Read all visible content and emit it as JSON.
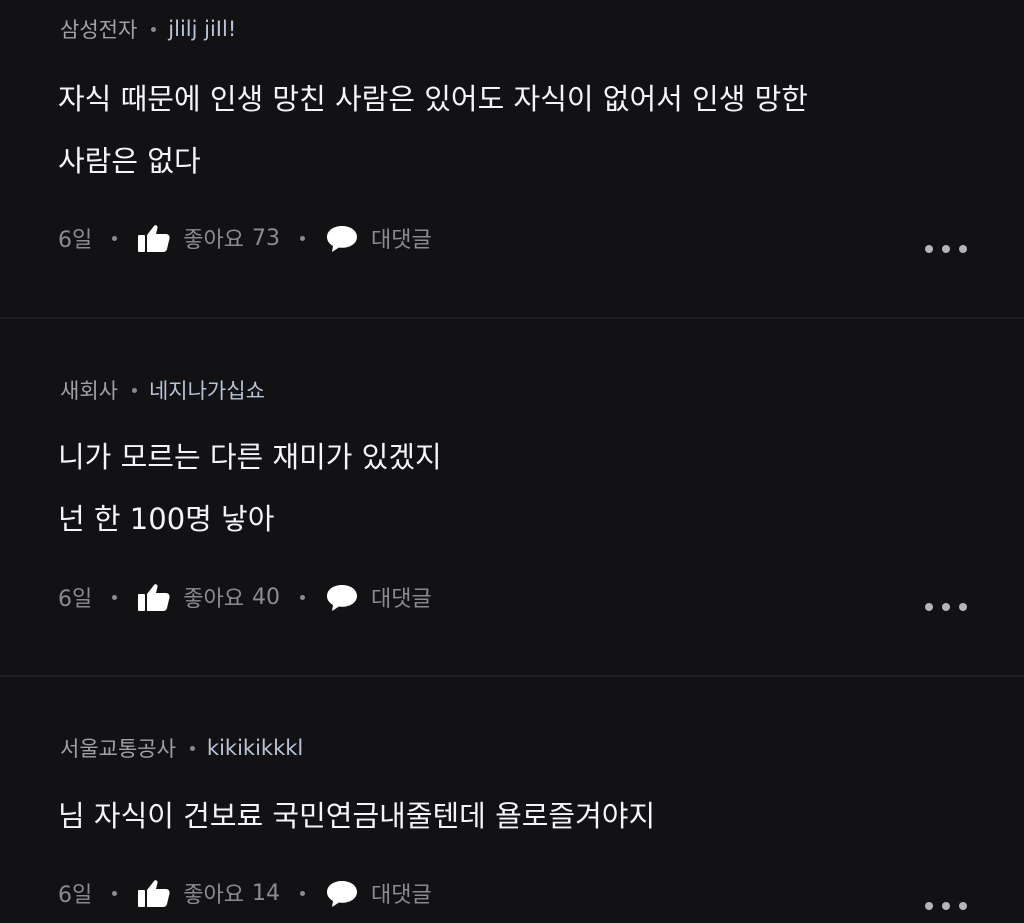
{
  "comments": [
    {
      "company": "삼성전자",
      "nickname": "jlilj jiIl!",
      "lines": [
        "자식 때문에 인생 망친 사람은 있어도 자식이 없어서 인생 망한",
        "사람은 없다"
      ],
      "time": "6일",
      "like_label": "좋아요",
      "like_count": "73",
      "reply_label": "대댓글"
    },
    {
      "company": "새회사",
      "nickname": "네지나가십쇼",
      "lines": [
        "니가 모르는 다른 재미가 있겠지",
        "넌 한 100명 낳아"
      ],
      "time": "6일",
      "like_label": "좋아요",
      "like_count": "40",
      "reply_label": "대댓글"
    },
    {
      "company": "서울교통공사",
      "nickname": "kikikikkkl",
      "lines": [
        "님 자식이 건보료 국민연금내줄텐데 욜로즐겨야지"
      ],
      "time": "6일",
      "like_label": "좋아요",
      "like_count": "14",
      "reply_label": "대댓글"
    }
  ],
  "icons": {
    "like": "thumbs-up-icon",
    "reply": "speech-bubble-icon",
    "more": "more-options-icon"
  },
  "colors": {
    "background": "#121214",
    "nickname": "#b9c2d6",
    "body_text": "#f5f5f7",
    "meta_text": "#8b8b91"
  }
}
